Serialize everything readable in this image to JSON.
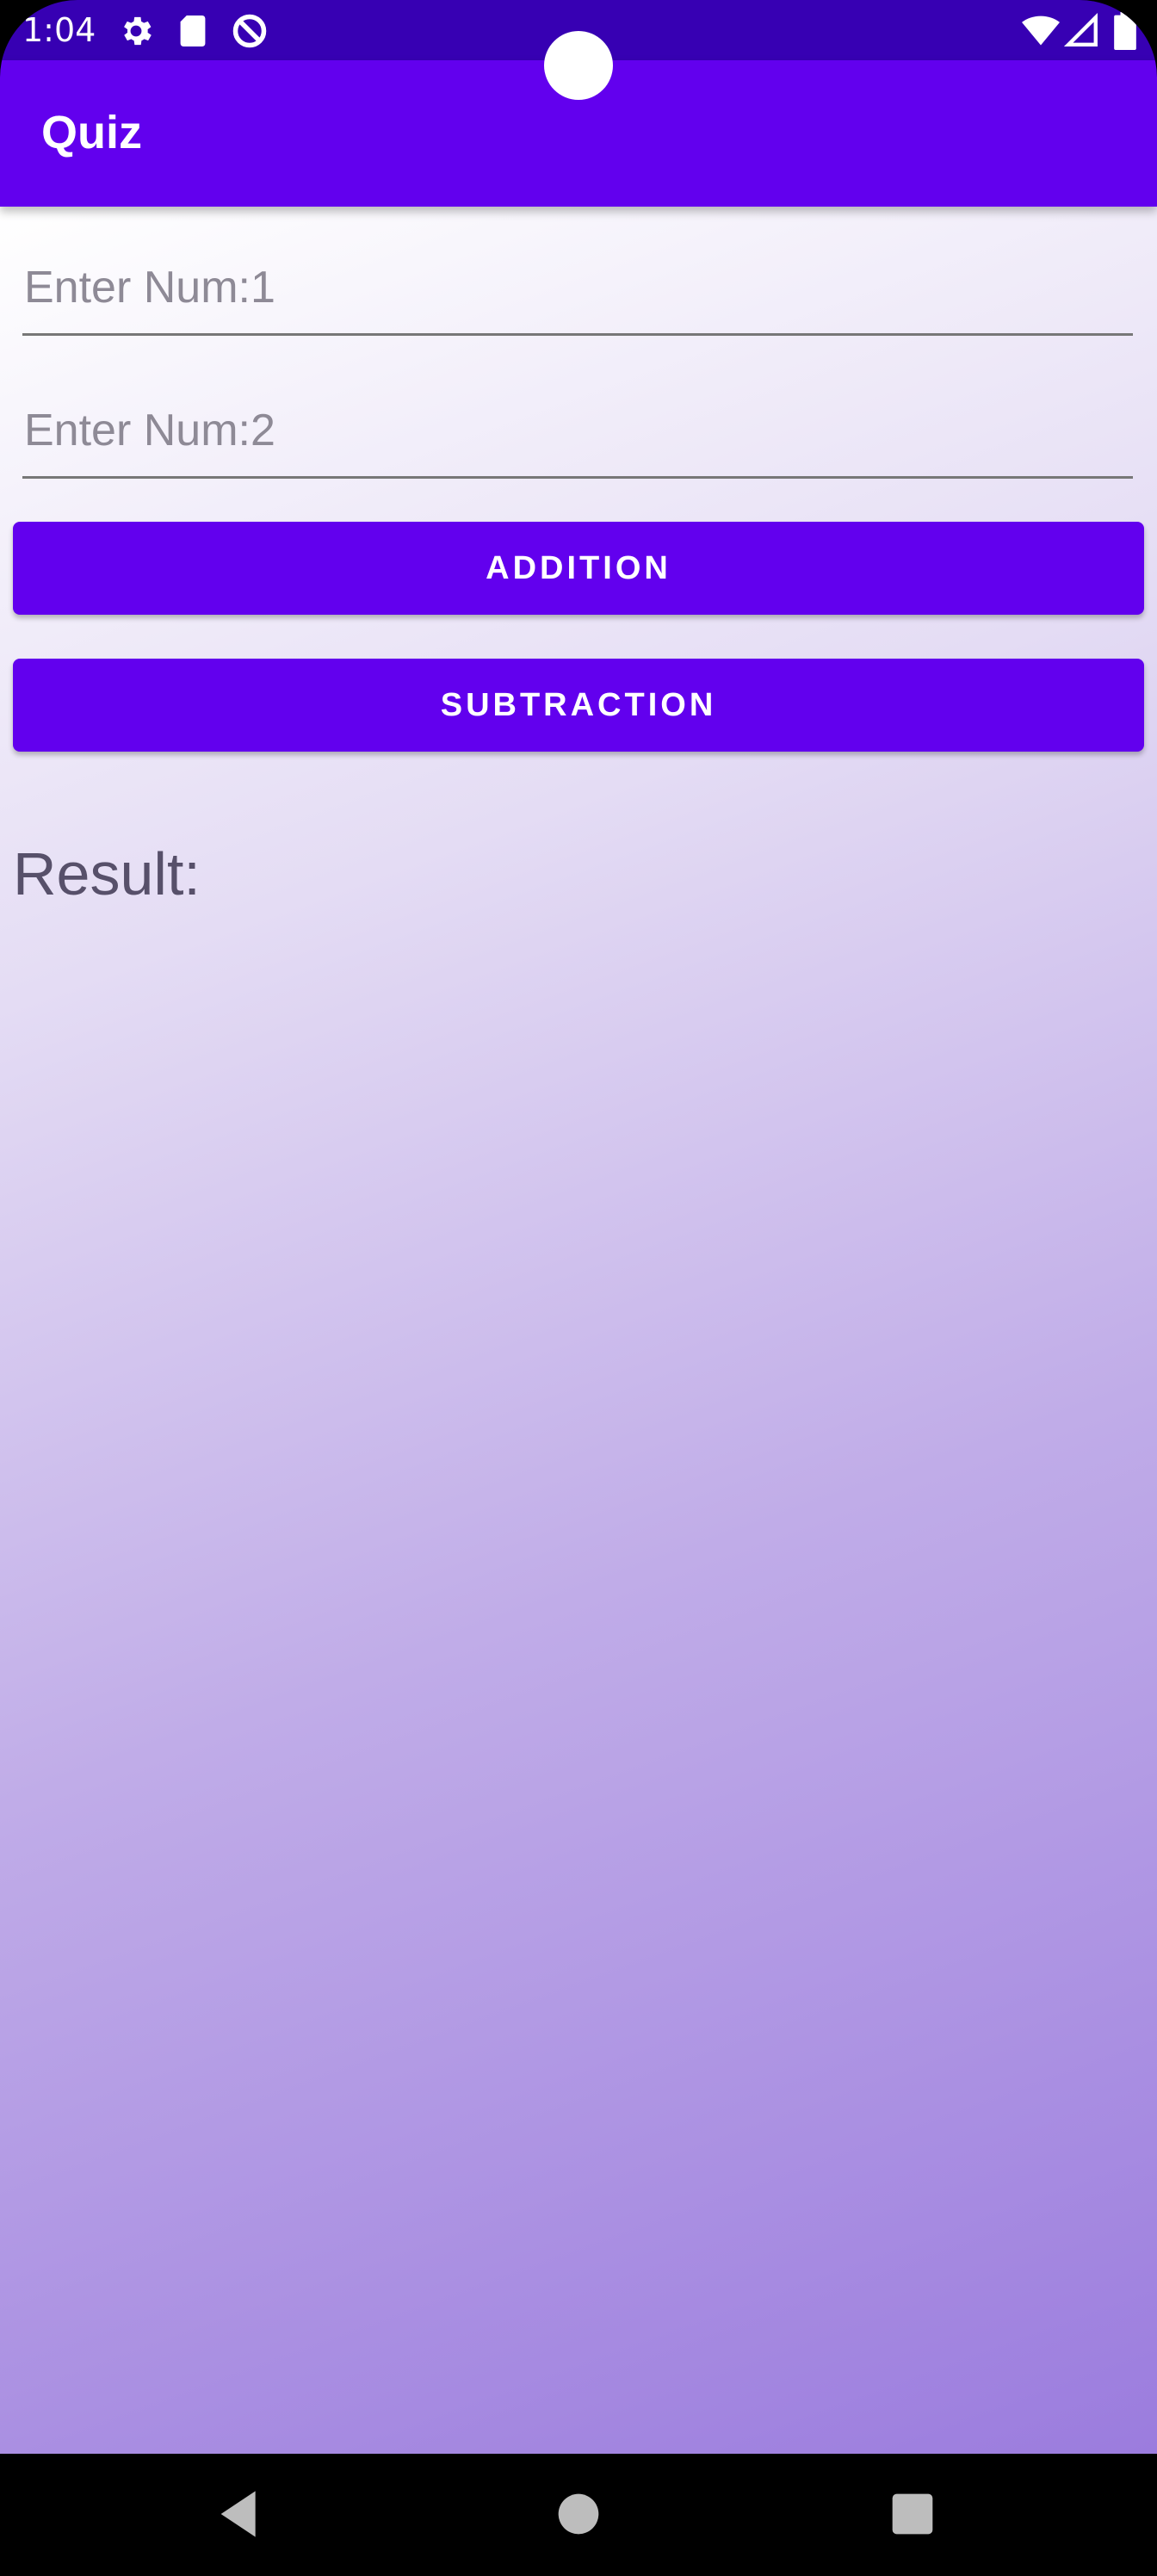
{
  "status_bar": {
    "time": "1:04",
    "icons": [
      "gear-icon",
      "sd-card-icon",
      "dnd-icon",
      "wifi-icon",
      "signal-icon",
      "battery-icon"
    ],
    "color": "#3700B3"
  },
  "app_bar": {
    "title": "Quiz",
    "color": "#6200EE"
  },
  "form": {
    "num1_placeholder": "Enter Num:1",
    "num1_value": "",
    "num2_placeholder": "Enter Num:2",
    "num2_value": ""
  },
  "buttons": {
    "addition_label": "ADDITION",
    "subtraction_label": "SUBTRACTION",
    "color": "#6200EE"
  },
  "result": {
    "label": "Result:"
  },
  "nav_bar": {
    "icons": [
      "back-icon",
      "home-icon",
      "recents-icon"
    ]
  }
}
